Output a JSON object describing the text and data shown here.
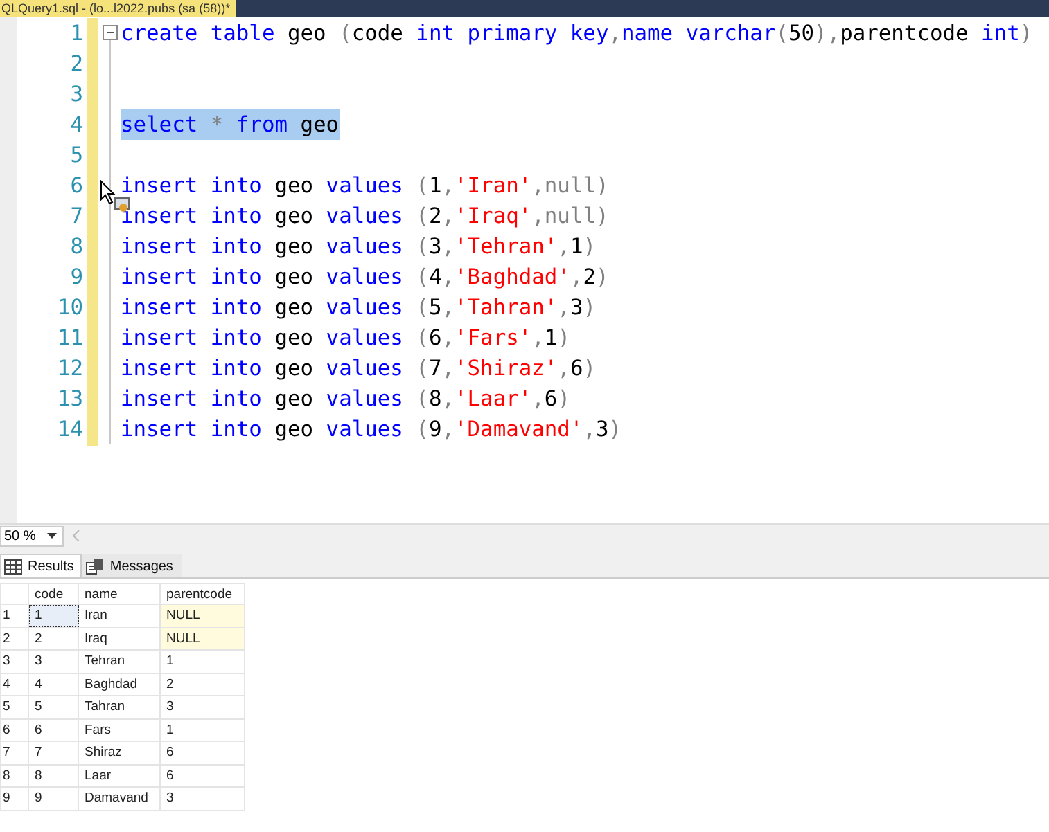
{
  "document_tab": {
    "title": "QLQuery1.sql - (lo...l2022.pubs (sa (58))*"
  },
  "editor": {
    "lines": [
      {
        "number": "1",
        "selected": false,
        "tokens": [
          {
            "kind": "keyword",
            "text": "create "
          },
          {
            "kind": "keyword",
            "text": "table "
          },
          {
            "kind": "plain",
            "text": "geo "
          },
          {
            "kind": "operator",
            "text": "("
          },
          {
            "kind": "plain",
            "text": "code "
          },
          {
            "kind": "keyword",
            "text": "int "
          },
          {
            "kind": "keyword",
            "text": "primary "
          },
          {
            "kind": "keyword",
            "text": "key"
          },
          {
            "kind": "operator",
            "text": ","
          },
          {
            "kind": "keyword",
            "text": "name "
          },
          {
            "kind": "keyword",
            "text": "varchar"
          },
          {
            "kind": "operator",
            "text": "("
          },
          {
            "kind": "plain",
            "text": "50"
          },
          {
            "kind": "operator",
            "text": "),"
          },
          {
            "kind": "plain",
            "text": "parentcode "
          },
          {
            "kind": "keyword",
            "text": "int"
          },
          {
            "kind": "operator",
            "text": ")"
          }
        ]
      },
      {
        "number": "2",
        "selected": false
      },
      {
        "number": "3",
        "selected": false
      },
      {
        "number": "4",
        "selected": true,
        "tokens": [
          {
            "kind": "keyword",
            "text": "select "
          },
          {
            "kind": "operator",
            "text": "* "
          },
          {
            "kind": "keyword",
            "text": "from "
          },
          {
            "kind": "plain",
            "text": "geo"
          }
        ]
      },
      {
        "number": "5",
        "selected": false
      },
      {
        "number": "6",
        "selected": false,
        "tokens": [
          {
            "kind": "keyword",
            "text": "insert "
          },
          {
            "kind": "keyword",
            "text": "into "
          },
          {
            "kind": "plain",
            "text": "geo "
          },
          {
            "kind": "keyword",
            "text": "values "
          },
          {
            "kind": "operator",
            "text": "("
          },
          {
            "kind": "plain",
            "text": "1"
          },
          {
            "kind": "operator",
            "text": ","
          },
          {
            "kind": "string",
            "text": "'Iran'"
          },
          {
            "kind": "operator",
            "text": ","
          },
          {
            "kind": "operator",
            "text": "null"
          },
          {
            "kind": "operator",
            "text": ")"
          }
        ]
      },
      {
        "number": "7",
        "selected": false,
        "tokens": [
          {
            "kind": "keyword",
            "text": "insert "
          },
          {
            "kind": "keyword",
            "text": "into "
          },
          {
            "kind": "plain",
            "text": "geo "
          },
          {
            "kind": "keyword",
            "text": "values "
          },
          {
            "kind": "operator",
            "text": "("
          },
          {
            "kind": "plain",
            "text": "2"
          },
          {
            "kind": "operator",
            "text": ","
          },
          {
            "kind": "string",
            "text": "'Iraq'"
          },
          {
            "kind": "operator",
            "text": ","
          },
          {
            "kind": "operator",
            "text": "null"
          },
          {
            "kind": "operator",
            "text": ")"
          }
        ]
      },
      {
        "number": "8",
        "selected": false,
        "tokens": [
          {
            "kind": "keyword",
            "text": "insert "
          },
          {
            "kind": "keyword",
            "text": "into "
          },
          {
            "kind": "plain",
            "text": "geo "
          },
          {
            "kind": "keyword",
            "text": "values "
          },
          {
            "kind": "operator",
            "text": "("
          },
          {
            "kind": "plain",
            "text": "3"
          },
          {
            "kind": "operator",
            "text": ","
          },
          {
            "kind": "string",
            "text": "'Tehran'"
          },
          {
            "kind": "operator",
            "text": ","
          },
          {
            "kind": "plain",
            "text": "1"
          },
          {
            "kind": "operator",
            "text": ")"
          }
        ]
      },
      {
        "number": "9",
        "selected": false,
        "tokens": [
          {
            "kind": "keyword",
            "text": "insert "
          },
          {
            "kind": "keyword",
            "text": "into "
          },
          {
            "kind": "plain",
            "text": "geo "
          },
          {
            "kind": "keyword",
            "text": "values "
          },
          {
            "kind": "operator",
            "text": "("
          },
          {
            "kind": "plain",
            "text": "4"
          },
          {
            "kind": "operator",
            "text": ","
          },
          {
            "kind": "string",
            "text": "'Baghdad'"
          },
          {
            "kind": "operator",
            "text": ","
          },
          {
            "kind": "plain",
            "text": "2"
          },
          {
            "kind": "operator",
            "text": ")"
          }
        ]
      },
      {
        "number": "10",
        "selected": false,
        "tokens": [
          {
            "kind": "keyword",
            "text": "insert "
          },
          {
            "kind": "keyword",
            "text": "into "
          },
          {
            "kind": "plain",
            "text": "geo "
          },
          {
            "kind": "keyword",
            "text": "values "
          },
          {
            "kind": "operator",
            "text": "("
          },
          {
            "kind": "plain",
            "text": "5"
          },
          {
            "kind": "operator",
            "text": ","
          },
          {
            "kind": "string",
            "text": "'Tahran'"
          },
          {
            "kind": "operator",
            "text": ","
          },
          {
            "kind": "plain",
            "text": "3"
          },
          {
            "kind": "operator",
            "text": ")"
          }
        ]
      },
      {
        "number": "11",
        "selected": false,
        "tokens": [
          {
            "kind": "keyword",
            "text": "insert "
          },
          {
            "kind": "keyword",
            "text": "into "
          },
          {
            "kind": "plain",
            "text": "geo "
          },
          {
            "kind": "keyword",
            "text": "values "
          },
          {
            "kind": "operator",
            "text": "("
          },
          {
            "kind": "plain",
            "text": "6"
          },
          {
            "kind": "operator",
            "text": ","
          },
          {
            "kind": "string",
            "text": "'Fars'"
          },
          {
            "kind": "operator",
            "text": ","
          },
          {
            "kind": "plain",
            "text": "1"
          },
          {
            "kind": "operator",
            "text": ")"
          }
        ]
      },
      {
        "number": "12",
        "selected": false,
        "tokens": [
          {
            "kind": "keyword",
            "text": "insert "
          },
          {
            "kind": "keyword",
            "text": "into "
          },
          {
            "kind": "plain",
            "text": "geo "
          },
          {
            "kind": "keyword",
            "text": "values "
          },
          {
            "kind": "operator",
            "text": "("
          },
          {
            "kind": "plain",
            "text": "7"
          },
          {
            "kind": "operator",
            "text": ","
          },
          {
            "kind": "string",
            "text": "'Shiraz'"
          },
          {
            "kind": "operator",
            "text": ","
          },
          {
            "kind": "plain",
            "text": "6"
          },
          {
            "kind": "operator",
            "text": ")"
          }
        ]
      },
      {
        "number": "13",
        "selected": false,
        "tokens": [
          {
            "kind": "keyword",
            "text": "insert "
          },
          {
            "kind": "keyword",
            "text": "into "
          },
          {
            "kind": "plain",
            "text": "geo "
          },
          {
            "kind": "keyword",
            "text": "values "
          },
          {
            "kind": "operator",
            "text": "("
          },
          {
            "kind": "plain",
            "text": "8"
          },
          {
            "kind": "operator",
            "text": ","
          },
          {
            "kind": "string",
            "text": "'Laar'"
          },
          {
            "kind": "operator",
            "text": ","
          },
          {
            "kind": "plain",
            "text": "6"
          },
          {
            "kind": "operator",
            "text": ")"
          }
        ]
      },
      {
        "number": "14",
        "selected": false,
        "tokens": [
          {
            "kind": "keyword",
            "text": "insert "
          },
          {
            "kind": "keyword",
            "text": "into "
          },
          {
            "kind": "plain",
            "text": "geo "
          },
          {
            "kind": "keyword",
            "text": "values "
          },
          {
            "kind": "operator",
            "text": "("
          },
          {
            "kind": "plain",
            "text": "9"
          },
          {
            "kind": "operator",
            "text": ","
          },
          {
            "kind": "string",
            "text": "'Damavand'"
          },
          {
            "kind": "operator",
            "text": ","
          },
          {
            "kind": "plain",
            "text": "3"
          },
          {
            "kind": "operator",
            "text": ")"
          }
        ]
      }
    ]
  },
  "zoom": {
    "value": "50 %"
  },
  "result_tabs": [
    {
      "label": "Results",
      "selected": true
    },
    {
      "label": "Messages",
      "selected": false
    }
  ],
  "grid": {
    "columns": [
      "code",
      "name",
      "parentcode"
    ],
    "rows": [
      {
        "number": "1",
        "cells": [
          "1",
          "Iran",
          "NULL"
        ],
        "null_cells": [
          false,
          false,
          true
        ],
        "focused": true
      },
      {
        "number": "2",
        "cells": [
          "2",
          "Iraq",
          "NULL"
        ],
        "null_cells": [
          false,
          false,
          true
        ],
        "focused": false
      },
      {
        "number": "3",
        "cells": [
          "3",
          "Tehran",
          "1"
        ],
        "null_cells": [
          false,
          false,
          false
        ],
        "focused": false
      },
      {
        "number": "4",
        "cells": [
          "4",
          "Baghdad",
          "2"
        ],
        "null_cells": [
          false,
          false,
          false
        ],
        "focused": false
      },
      {
        "number": "5",
        "cells": [
          "5",
          "Tahran",
          "3"
        ],
        "null_cells": [
          false,
          false,
          false
        ],
        "focused": false
      },
      {
        "number": "6",
        "cells": [
          "6",
          "Fars",
          "1"
        ],
        "null_cells": [
          false,
          false,
          false
        ],
        "focused": false
      },
      {
        "number": "7",
        "cells": [
          "7",
          "Shiraz",
          "6"
        ],
        "null_cells": [
          false,
          false,
          false
        ],
        "focused": false
      },
      {
        "number": "8",
        "cells": [
          "8",
          "Laar",
          "6"
        ],
        "null_cells": [
          false,
          false,
          false
        ],
        "focused": false
      },
      {
        "number": "9",
        "cells": [
          "9",
          "Damavand",
          "3"
        ],
        "null_cells": [
          false,
          false,
          false
        ],
        "focused": false
      }
    ]
  }
}
